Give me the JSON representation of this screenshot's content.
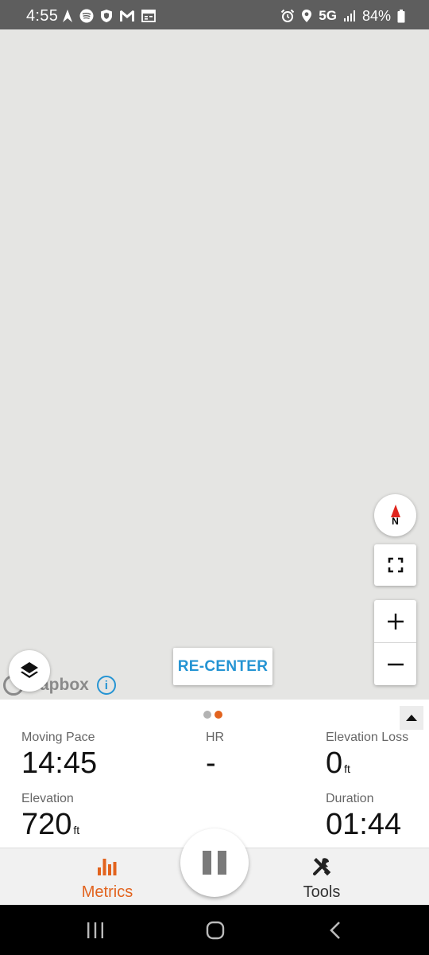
{
  "status_bar": {
    "time": "4:55",
    "network": "5G",
    "battery": "84%",
    "left_icons": [
      "navigation-icon",
      "spotify-icon",
      "shield-icon",
      "gmail-icon",
      "calendar-icon"
    ],
    "right_icons": [
      "alarm-icon",
      "location-icon",
      "signal-icon",
      "battery-icon"
    ]
  },
  "map": {
    "compass_label": "N",
    "recenter_label": "RE-CENTER",
    "attribution_text": "apbox",
    "info_label": "i",
    "background_color": "#e5e5e3"
  },
  "metrics": {
    "moving_pace": {
      "label": "Moving Pace",
      "value": "14:45",
      "unit": ""
    },
    "hr": {
      "label": "HR",
      "value": "-",
      "unit": ""
    },
    "elevation_loss": {
      "label": "Elevation Loss",
      "value": "0",
      "unit": "ft"
    },
    "elevation": {
      "label": "Elevation",
      "value": "720",
      "unit": "ft"
    },
    "duration": {
      "label": "Duration",
      "value": "01:44",
      "unit": ""
    },
    "page_count": 2,
    "active_page": 2
  },
  "tabs": {
    "metrics_label": "Metrics",
    "tools_label": "Tools",
    "active": "Metrics"
  },
  "colors": {
    "accent": "#e2631e",
    "recenter_blue": "#2594d3",
    "status_bar": "#5e5e5e",
    "compass_red": "#e0261f"
  }
}
